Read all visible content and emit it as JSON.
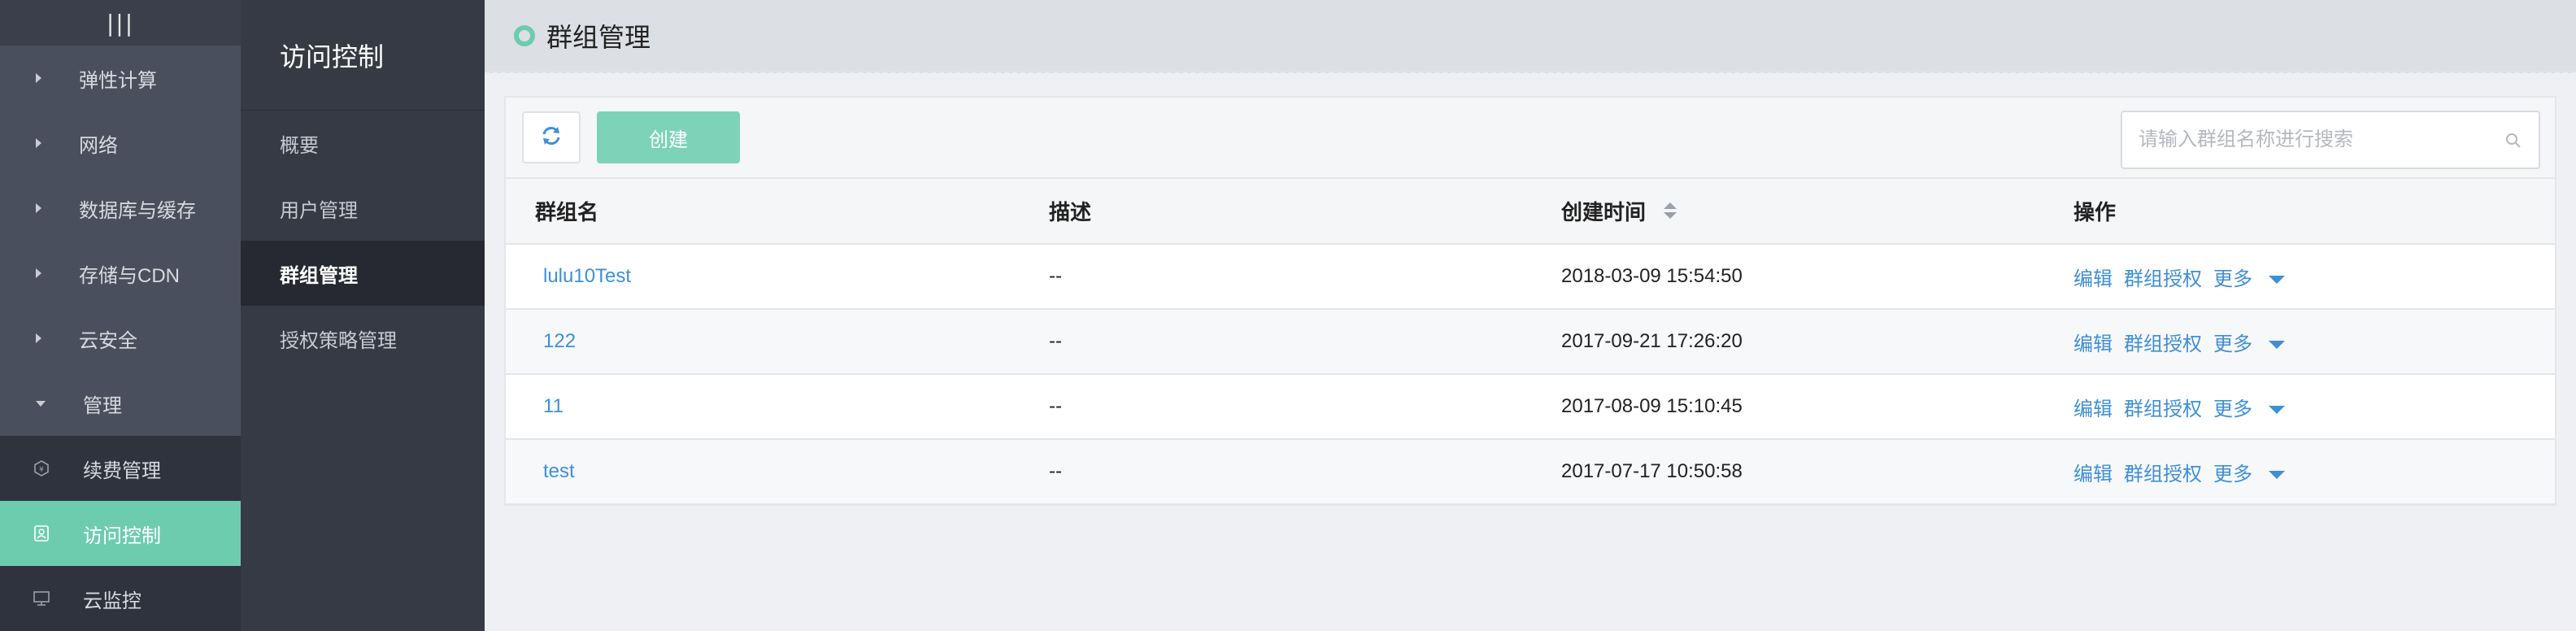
{
  "nav": {
    "groups": [
      {
        "label": "弹性计算",
        "expanded": false
      },
      {
        "label": "网络",
        "expanded": false
      },
      {
        "label": "数据库与缓存",
        "expanded": false
      },
      {
        "label": "存储与CDN",
        "expanded": false
      },
      {
        "label": "云安全",
        "expanded": false
      },
      {
        "label": "管理",
        "expanded": true
      }
    ],
    "sub_items": [
      {
        "label": "续费管理",
        "icon": "renewal-icon"
      },
      {
        "label": "访问控制",
        "icon": "access-control-icon",
        "active": true
      },
      {
        "label": "云监控",
        "icon": "monitor-icon"
      }
    ]
  },
  "subnav": {
    "title": "访问控制",
    "items": [
      {
        "label": "概要"
      },
      {
        "label": "用户管理"
      },
      {
        "label": "群组管理",
        "active": true
      },
      {
        "label": "授权策略管理"
      }
    ]
  },
  "header": {
    "title": "群组管理"
  },
  "toolbar": {
    "create_label": "创建",
    "search_placeholder": "请输入群组名称进行搜索"
  },
  "table": {
    "columns": [
      "群组名",
      "描述",
      "创建时间",
      "操作"
    ],
    "rows": [
      {
        "name": "lulu10Test",
        "desc": "--",
        "created": "2018-03-09 15:54:50"
      },
      {
        "name": "122",
        "desc": "--",
        "created": "2017-09-21 17:26:20"
      },
      {
        "name": "11",
        "desc": "--",
        "created": "2017-08-09 15:10:45"
      },
      {
        "name": "test",
        "desc": "--",
        "created": "2017-07-17 10:50:58"
      }
    ],
    "actions": {
      "edit": "编辑",
      "authorize": "群组授权",
      "more": "更多"
    }
  },
  "colors": {
    "accent": "#6dccae",
    "link": "#3f8fd6",
    "nav_bg": "#2f333d"
  }
}
